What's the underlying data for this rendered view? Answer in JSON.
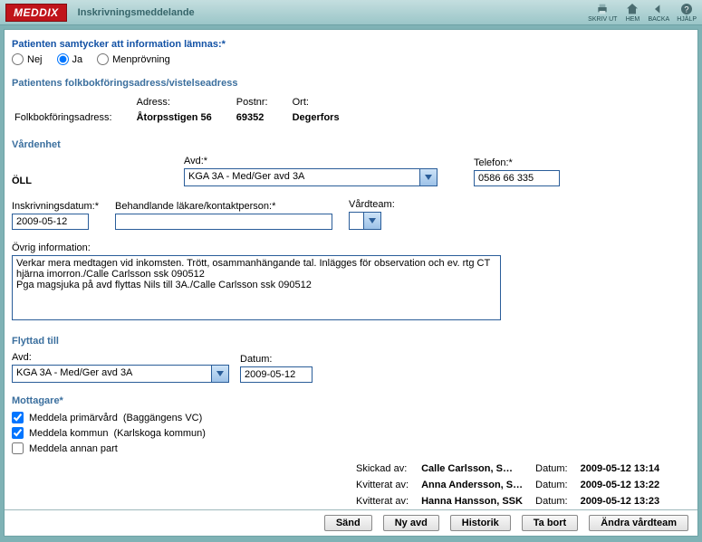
{
  "titlebar": {
    "logo": "MEDDIX",
    "title": "Inskrivningsmeddelande",
    "icons": {
      "print": "SKRIV UT",
      "home": "HEM",
      "back": "BACKA",
      "help": "HJÄLP"
    }
  },
  "consent": {
    "title": "Patienten samtycker att information lämnas:*",
    "options": {
      "no": "Nej",
      "yes": "Ja",
      "menprovning": "Menprövning"
    },
    "selected": "yes"
  },
  "address": {
    "title": "Patientens folkbokföringsadress/vistelseadress",
    "labels": {
      "reg": "Folkbokföringsadress:",
      "adress": "Adress:",
      "postnr": "Postnr:",
      "ort": "Ort:"
    },
    "values": {
      "adress": "Åtorpsstigen 56",
      "postnr": "69352",
      "ort": "Degerfors"
    }
  },
  "vard": {
    "oll": "ÖLL",
    "title": "Vårdenhet",
    "avd_label": "Avd:*",
    "avd_value": "KGA 3A - Med/Ger avd 3A",
    "tel_label": "Telefon:*",
    "tel_value": "0586 66 335"
  },
  "inskr": {
    "date_label": "Inskrivningsdatum:*",
    "date_value": "2009-05-12",
    "doctor_label": "Behandlande läkare/kontaktperson:*",
    "doctor_value": "",
    "team_label": "Vårdteam:",
    "team_value": ""
  },
  "info": {
    "label": "Övrig information:",
    "text": "Verkar mera medtagen vid inkomsten. Trött, osammanhängande tal. Inlägges för observation och ev. rtg CT hjärna imorron./Calle Carlsson ssk 090512\nPga magsjuka på avd flyttas Nils till 3A./Calle Carlsson ssk 090512"
  },
  "flyttad": {
    "title": "Flyttad till",
    "avd_label": "Avd:",
    "avd_value": "KGA 3A - Med/Ger avd 3A",
    "date_label": "Datum:",
    "date_value": "2009-05-12"
  },
  "mottagare": {
    "title": "Mottagare*",
    "primar": {
      "label": "Meddela primärvård",
      "extra": "(Baggängens VC)",
      "checked": true
    },
    "kommun": {
      "label": "Meddela kommun",
      "extra": "(Karlskoga kommun)",
      "checked": true
    },
    "annan": {
      "label": "Meddela annan part",
      "checked": false
    }
  },
  "receipts": {
    "labels": {
      "sent": "Skickad av:",
      "ack": "Kvitterat av:",
      "date": "Datum:"
    },
    "rows": [
      {
        "by": "Calle Carlsson, S…",
        "date": "2009-05-12 13:14",
        "label": "Skickad av:"
      },
      {
        "by": "Anna Andersson, S…",
        "date": "2009-05-12 13:22",
        "label": "Kvitterat av:"
      },
      {
        "by": "Hanna Hansson, SSK",
        "date": "2009-05-12 13:23",
        "label": "Kvitterat av:"
      },
      {
        "by": "",
        "date": "",
        "label": "Kvitterat av:"
      }
    ]
  },
  "buttons": {
    "send": "Sänd",
    "newdept": "Ny avd",
    "history": "Historik",
    "delete": "Ta bort",
    "changeteam": "Ändra vårdteam"
  }
}
